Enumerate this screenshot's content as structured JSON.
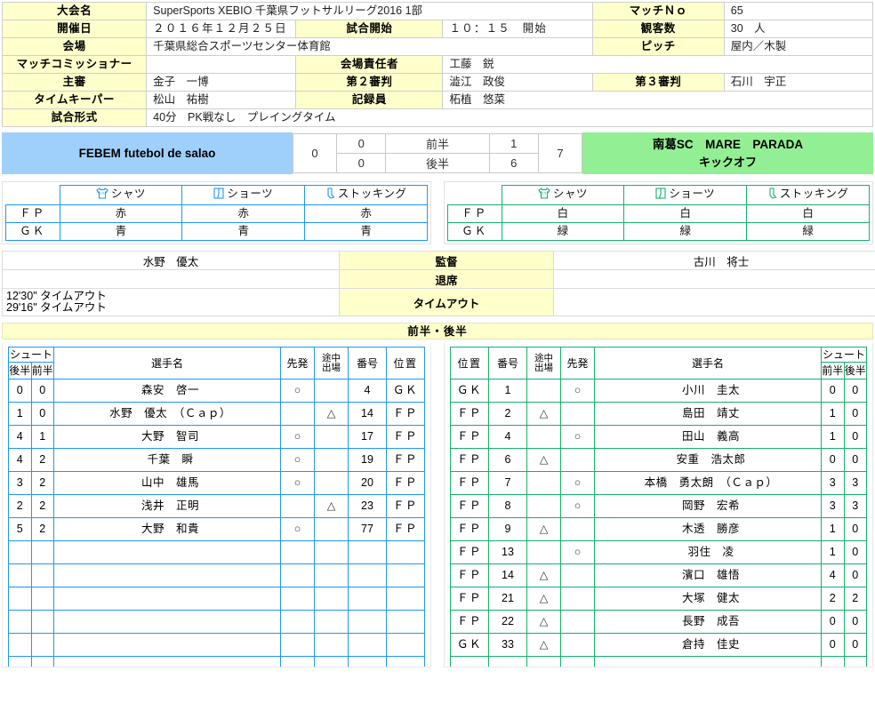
{
  "colors": {
    "label_bg": "#ffffcc",
    "home_bg": "#9fd0fb",
    "away_bg": "#93ef93",
    "home_line": "#2196f3",
    "away_line": "#17b06b"
  },
  "info": {
    "tournament_label": "大会名",
    "tournament_value": "SuperSports XEBIO 千葉県フットサルリーグ2016 1部",
    "match_no_label": "マッチＮｏ",
    "match_no_value": "65",
    "date_label": "開催日",
    "date_value": "２０１６年１２月２５日",
    "kickoff_label": "試合開始",
    "kickoff_value": "１０：１５　開始",
    "spectators_label": "観客数",
    "spectators_value": "30　人",
    "venue_label": "会場",
    "venue_value": "千葉県総合スポーツセンター体育館",
    "pitch_label": "ピッチ",
    "pitch_value": "屋内／木製",
    "commissioner_label": "マッチコミッショナー",
    "commissioner_value": "",
    "venue_manager_label": "会場責任者",
    "venue_manager_value": "工藤　鋭",
    "referee1_label": "主審",
    "referee1_value": "金子　一博",
    "referee2_label": "第２審判",
    "referee2_value": "澁江　政俊",
    "referee3_label": "第３審判",
    "referee3_value": "石川　宇正",
    "timekeeper_label": "タイムキーパー",
    "timekeeper_value": "松山　祐樹",
    "recorder_label": "記録員",
    "recorder_value": "柘植　悠菜",
    "format_label": "試合形式",
    "format_value": "40分　PK戦なし　プレイングタイム"
  },
  "score": {
    "home_team": "FEBEM futebol de salao",
    "away_team": "南葛SC　MARE　PARADA",
    "away_note": "キックオフ",
    "home_total": "0",
    "away_total": "7",
    "first_half_label": "前半",
    "second_half_label": "後半",
    "home_first": "0",
    "home_second": "0",
    "away_first": "1",
    "away_second": "6"
  },
  "uniform": {
    "col_shirt": "シャツ",
    "col_shorts": "ショーツ",
    "col_socks": "ストッキング",
    "row_fp": "ＦＰ",
    "row_gk": "ＧＫ",
    "home": {
      "fp": [
        "赤",
        "赤",
        "赤"
      ],
      "gk": [
        "青",
        "青",
        "青"
      ]
    },
    "away": {
      "fp": [
        "白",
        "白",
        "白"
      ],
      "gk": [
        "緑",
        "緑",
        "緑"
      ]
    }
  },
  "staff": {
    "coach_label": "監督",
    "sendoff_label": "退席",
    "timeout_label": "タイムアウト",
    "home_coach": "水野　優太",
    "away_coach": "古川　将士",
    "home_sendoff": "",
    "away_sendoff": "",
    "home_timeout": "12'30\" タイムアウト\n29'16\" タイムアウト",
    "away_timeout": ""
  },
  "banner": "前半・後半",
  "table_headers": {
    "shoot": "シュート",
    "first": "前半",
    "second": "後半",
    "player_name": "選手名",
    "starter": "先発",
    "sub": "途中\n出場",
    "number": "番号",
    "position": "位置"
  },
  "home_players": [
    {
      "second": "0",
      "first": "0",
      "name": "森安　啓一",
      "starter": "○",
      "sub": "",
      "number": "4",
      "position": "ＧＫ"
    },
    {
      "second": "1",
      "first": "0",
      "name": "水野　優太　（Ｃａｐ）",
      "starter": "",
      "sub": "△",
      "number": "14",
      "position": "ＦＰ"
    },
    {
      "second": "4",
      "first": "1",
      "name": "大野　智司",
      "starter": "○",
      "sub": "",
      "number": "17",
      "position": "ＦＰ"
    },
    {
      "second": "4",
      "first": "2",
      "name": "千葉　瞬",
      "starter": "○",
      "sub": "",
      "number": "19",
      "position": "ＦＰ"
    },
    {
      "second": "3",
      "first": "2",
      "name": "山中　雄馬",
      "starter": "○",
      "sub": "",
      "number": "20",
      "position": "ＦＰ"
    },
    {
      "second": "2",
      "first": "2",
      "name": "浅井　正明",
      "starter": "",
      "sub": "△",
      "number": "23",
      "position": "ＦＰ"
    },
    {
      "second": "5",
      "first": "2",
      "name": "大野　和貴",
      "starter": "○",
      "sub": "",
      "number": "77",
      "position": "ＦＰ"
    }
  ],
  "home_blank_rows": 6,
  "away_players": [
    {
      "position": "ＧＫ",
      "number": "1",
      "sub": "",
      "starter": "○",
      "name": "小川　圭太",
      "first": "0",
      "second": "0"
    },
    {
      "position": "ＦＰ",
      "number": "2",
      "sub": "△",
      "starter": "",
      "name": "島田　靖丈",
      "first": "1",
      "second": "0"
    },
    {
      "position": "ＦＰ",
      "number": "4",
      "sub": "",
      "starter": "○",
      "name": "田山　義高",
      "first": "1",
      "second": "0"
    },
    {
      "position": "ＦＰ",
      "number": "6",
      "sub": "△",
      "starter": "",
      "name": "安重　浩太郎",
      "first": "0",
      "second": "0"
    },
    {
      "position": "ＦＰ",
      "number": "7",
      "sub": "",
      "starter": "○",
      "name": "本橋　勇太朗　（Ｃａｐ）",
      "first": "3",
      "second": "3"
    },
    {
      "position": "ＦＰ",
      "number": "8",
      "sub": "",
      "starter": "○",
      "name": "岡野　宏希",
      "first": "3",
      "second": "3"
    },
    {
      "position": "ＦＰ",
      "number": "9",
      "sub": "△",
      "starter": "",
      "name": "木透　勝彦",
      "first": "1",
      "second": "0"
    },
    {
      "position": "ＦＰ",
      "number": "13",
      "sub": "",
      "starter": "○",
      "name": "羽住　凌",
      "first": "1",
      "second": "0"
    },
    {
      "position": "ＦＰ",
      "number": "14",
      "sub": "△",
      "starter": "",
      "name": "濱口　雄悟",
      "first": "4",
      "second": "0"
    },
    {
      "position": "ＦＰ",
      "number": "21",
      "sub": "△",
      "starter": "",
      "name": "大塚　健太",
      "first": "2",
      "second": "2"
    },
    {
      "position": "ＦＰ",
      "number": "22",
      "sub": "△",
      "starter": "",
      "name": "長野　成吾",
      "first": "0",
      "second": "0"
    },
    {
      "position": "ＧＫ",
      "number": "33",
      "sub": "△",
      "starter": "",
      "name": "倉持　佳史",
      "first": "0",
      "second": "0"
    }
  ],
  "away_blank_rows": 1
}
